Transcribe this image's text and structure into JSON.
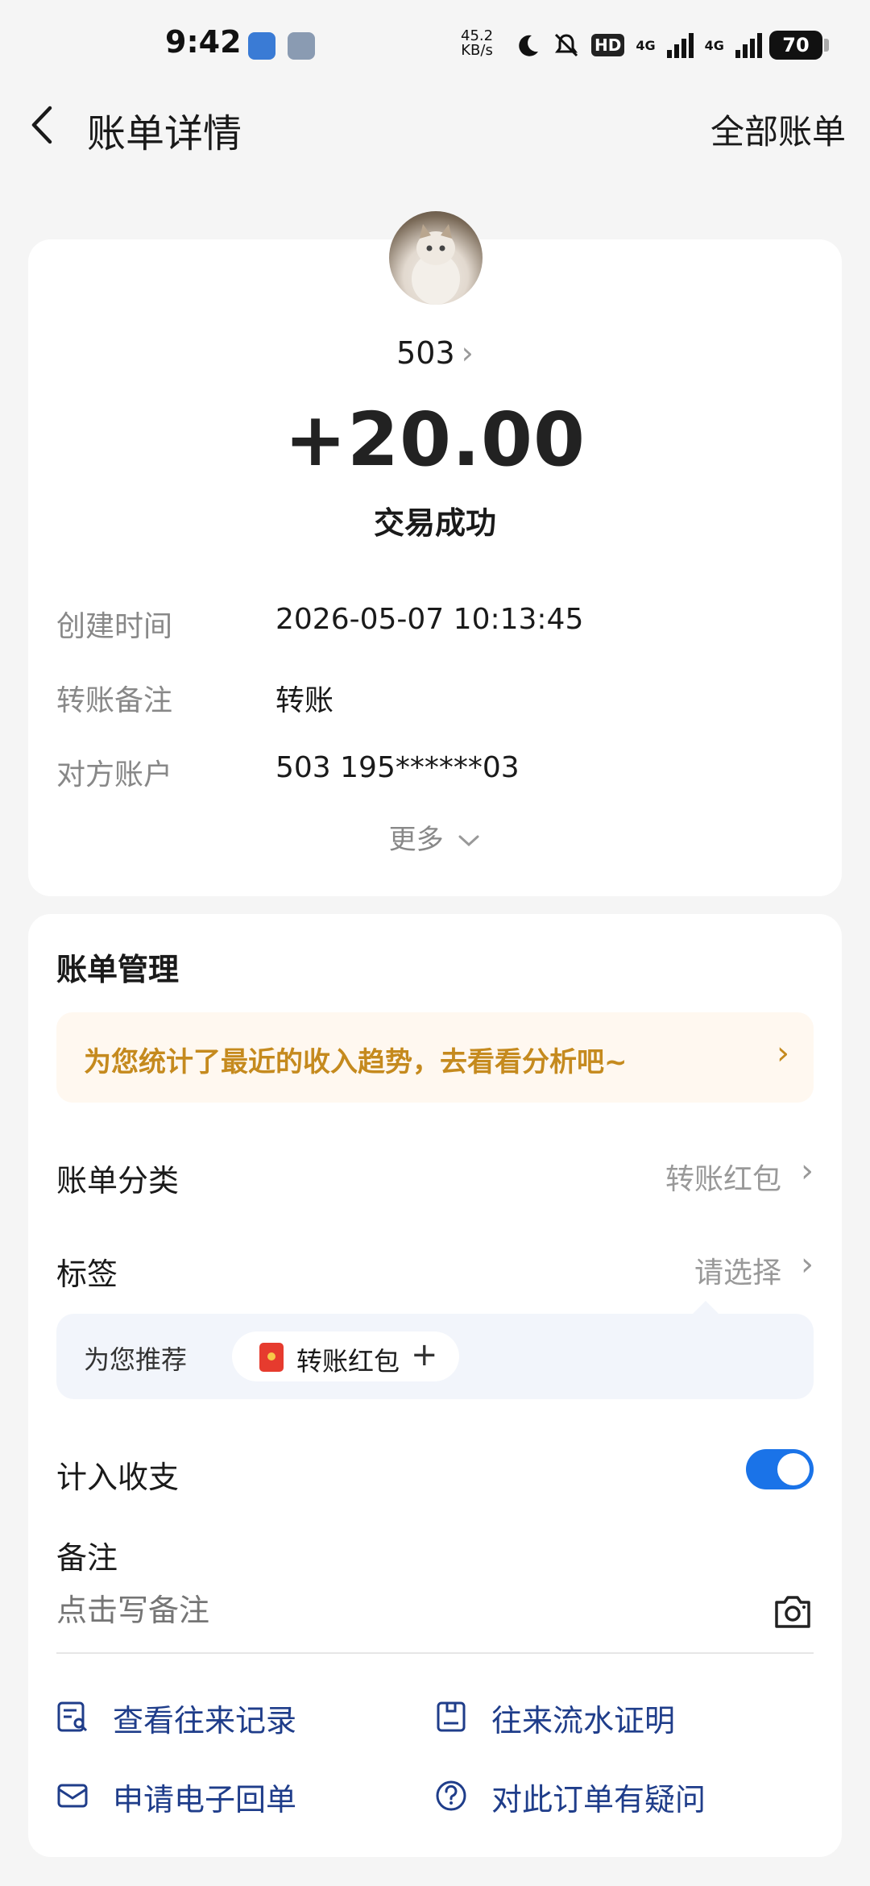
{
  "status_bar": {
    "time": "9:42",
    "net_speed_value": "45.2",
    "net_speed_unit": "KB/s",
    "hd_badge": "HD",
    "sig1": "4G",
    "sig2": "4G",
    "battery": "70"
  },
  "nav": {
    "title": "账单详情",
    "all_bills": "全部账单"
  },
  "transaction": {
    "payer_name": "503",
    "amount": "+20.00",
    "status": "交易成功",
    "details": [
      {
        "label": "创建时间",
        "value": "2026-05-07 10:13:45"
      },
      {
        "label": "转账备注",
        "value": "转账"
      },
      {
        "label": "对方账户",
        "value": "503 195******03"
      }
    ],
    "more": "更多"
  },
  "management": {
    "title": "账单管理",
    "banner": "为您统计了最近的收入趋势，去看看分析吧~",
    "category_label": "账单分类",
    "category_value": "转账红包",
    "tag_label": "标签",
    "tag_value": "请选择",
    "recommend_label": "为您推荐",
    "recommend_chip": "转账红包",
    "include_label": "计入收支",
    "include_on": true,
    "note_title": "备注",
    "note_placeholder": "点击写备注"
  },
  "links": {
    "records": "查看往来记录",
    "proof": "往来流水证明",
    "receipt": "申请电子回单",
    "question": "对此订单有疑问"
  },
  "colors": {
    "accent": "#1a73e8",
    "link": "#1f3d8a",
    "banner_text": "#c58a1e",
    "banner_bg": "#fff8f0",
    "page_bg": "#f5f5f5"
  }
}
